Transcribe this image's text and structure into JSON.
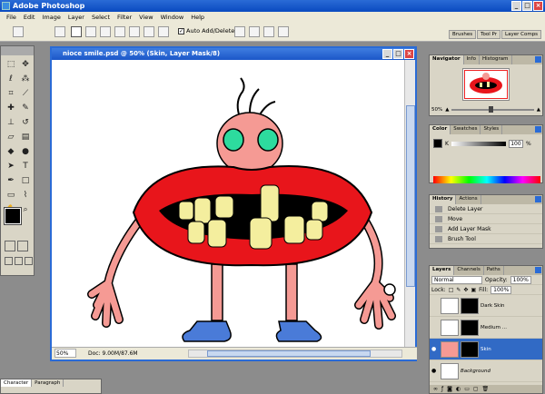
{
  "app": {
    "title": "Adobe Photoshop"
  },
  "menu": [
    "File",
    "Edit",
    "Image",
    "Layer",
    "Select",
    "Filter",
    "View",
    "Window",
    "Help"
  ],
  "options": {
    "auto_add_delete": "Auto Add/Delete"
  },
  "wells": [
    "Brushes",
    "Tool Pr",
    "Layer Comps"
  ],
  "document": {
    "title": "nioce smile.psd @ 50% (Skin, Layer Mask/8)",
    "zoom": "50%",
    "doc_size": "Doc: 9.00M/87.6M"
  },
  "character_panel": {
    "tabs": [
      "Character",
      "Paragraph"
    ]
  },
  "navigator": {
    "tabs": [
      "Navigator",
      "Info",
      "Histogram"
    ],
    "zoom": "50%"
  },
  "color_panel": {
    "tabs": [
      "Color",
      "Swatches",
      "Styles"
    ],
    "channel": "K",
    "value": "100",
    "unit": "%"
  },
  "history": {
    "tabs": [
      "History",
      "Actions"
    ],
    "items": [
      "Delete Layer",
      "Move",
      "Add Layer Mask",
      "Brush Tool"
    ]
  },
  "layers": {
    "tabs": [
      "Layers",
      "Channels",
      "Paths"
    ],
    "blend_mode": "Normal",
    "opacity_label": "Opacity:",
    "opacity": "100%",
    "lock_label": "Lock:",
    "fill_label": "Fill:",
    "fill": "100%",
    "items": [
      {
        "name": "Dark Skin"
      },
      {
        "name": "Medium ..."
      },
      {
        "name": "Skin"
      },
      {
        "name": "Background"
      }
    ]
  },
  "colors": {
    "accent": "#2a6bd6",
    "lips": "#e8151b",
    "skin": "#f59a94",
    "teeth": "#f4ee9e",
    "eyes": "#2ddb9e",
    "shoes": "#4a7bd8",
    "selection": "#316ac5"
  }
}
